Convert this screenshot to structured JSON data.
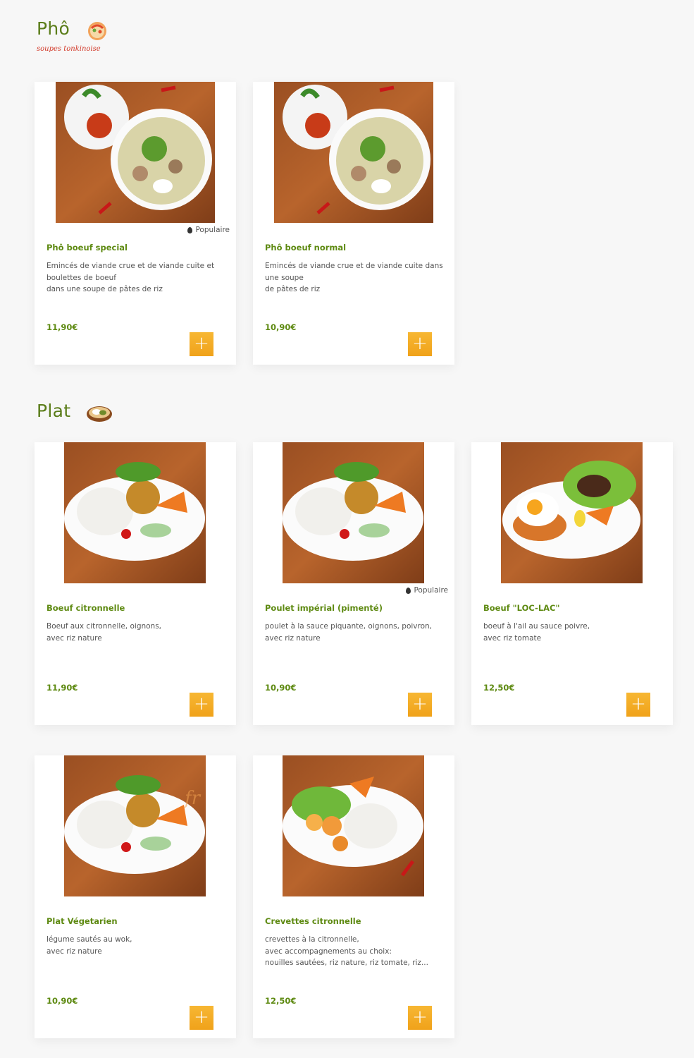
{
  "sections": [
    {
      "title": "Phô",
      "subtitle": "soupes tonkinoise",
      "icon": "pho-bowl-icon",
      "items": [
        {
          "name": "Phô boeuf special",
          "description": "Emincés de viande crue et de viande cuite et\nboulettes de boeuf\ndans une soupe de pâtes de riz",
          "price": "11,90€",
          "badge": "Populaire",
          "photo": "pho-photo"
        },
        {
          "name": "Phô boeuf normal",
          "description": "Emincés de viande crue et de viande cuite dans\nune soupe\nde pâtes de riz",
          "price": "10,90€",
          "badge": "",
          "photo": "pho-photo"
        }
      ]
    },
    {
      "title": "Plat",
      "subtitle": "",
      "icon": "plate-dish-icon",
      "items": [
        {
          "name": "Boeuf citronnelle",
          "description": "Boeuf aux citronnelle, oignons,\navec  riz nature",
          "price": "11,90€",
          "badge": "",
          "photo": "rice-plate-photo"
        },
        {
          "name": "Poulet impérial (pimenté)",
          "description": "poulet à la sauce piquante, oignons, poivron,\navec  riz nature",
          "price": "10,90€",
          "badge": "Populaire",
          "photo": "rice-plate-photo"
        },
        {
          "name": "Boeuf \"LOC-LAC\"",
          "description": "boeuf à l'ail au sauce poivre,\navec riz tomate",
          "price": "12,50€",
          "badge": "",
          "photo": "loclac-photo"
        },
        {
          "name": "Plat Végetarien",
          "description": "légume sautés au wok,\navec riz nature",
          "price": "10,90€",
          "badge": "",
          "photo": "rice-plate-photo"
        },
        {
          "name": "Crevettes citronnelle",
          "description": "crevettes à la citronnelle,\navec accompagnements au choix:\nnouilles sautées, riz nature, riz tomate, riz...",
          "price": "12,50€",
          "badge": "",
          "photo": "shrimp-photo"
        }
      ]
    }
  ],
  "add_button_symbol": "+",
  "watermark": "fr",
  "colors": {
    "accent_green": "#5e8a12",
    "add_button": "#f2a71e",
    "subtitle_red": "#d23a2a",
    "background": "#f7f7f7"
  }
}
